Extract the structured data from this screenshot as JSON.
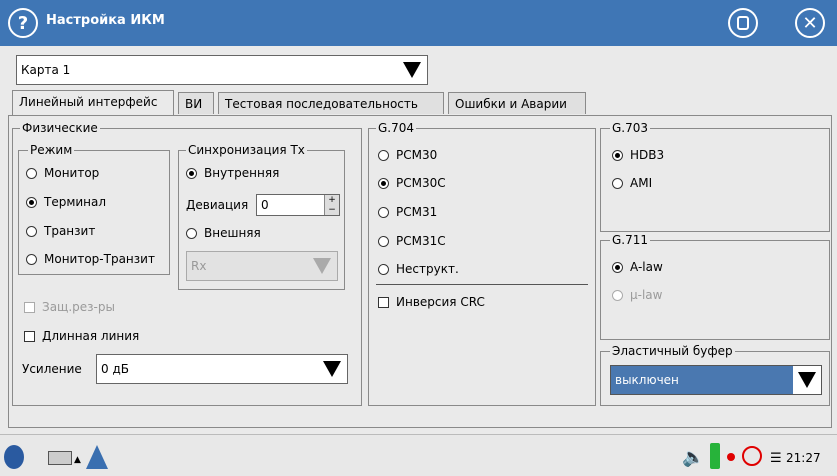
{
  "window": {
    "title": "Настройка ИКМ"
  },
  "card_select": {
    "value": "Карта 1"
  },
  "tabs": [
    {
      "label": "Линейный интерфейс",
      "active": true
    },
    {
      "label": "ВИ",
      "active": false
    },
    {
      "label": "Тестовая последовательность",
      "active": false
    },
    {
      "label": "Ошибки и Аварии",
      "active": false
    }
  ],
  "physical": {
    "legend": "Физические",
    "mode": {
      "legend": "Режим",
      "options": [
        "Монитор",
        "Терминал",
        "Транзит",
        "Монитор-Транзит"
      ],
      "selected": "Терминал"
    },
    "sync": {
      "legend": "Синхронизация Tx",
      "internal_label": "Внутренняя",
      "deviation_label": "Девиация",
      "deviation_value": "0",
      "external_label": "Внешняя",
      "external_source": "Rx"
    },
    "protection_label": "Защ.рез-ры",
    "long_line_label": "Длинная линия",
    "gain_label": "Усиление",
    "gain_value": "0 дБ"
  },
  "g704": {
    "legend": "G.704",
    "options": [
      "PCM30",
      "PCM30C",
      "PCM31",
      "PCM31C",
      "Неструкт."
    ],
    "selected": "PCM30C",
    "crc_label": "Инверсия CRC"
  },
  "g703": {
    "legend": "G.703",
    "options": [
      "HDB3",
      "AMI"
    ],
    "selected": "HDB3"
  },
  "g711": {
    "legend": "G.711",
    "options": [
      "A-law",
      "μ-law"
    ],
    "selected": "A-law"
  },
  "elastic": {
    "legend": "Эластичный буфер",
    "value": "выключен"
  },
  "taskbar": {
    "time": "21:27"
  },
  "colors": {
    "titlebar": "#3f76b5",
    "elastic_select": "#4a78b0",
    "battery": "#27b33a",
    "record": "#e00000"
  }
}
